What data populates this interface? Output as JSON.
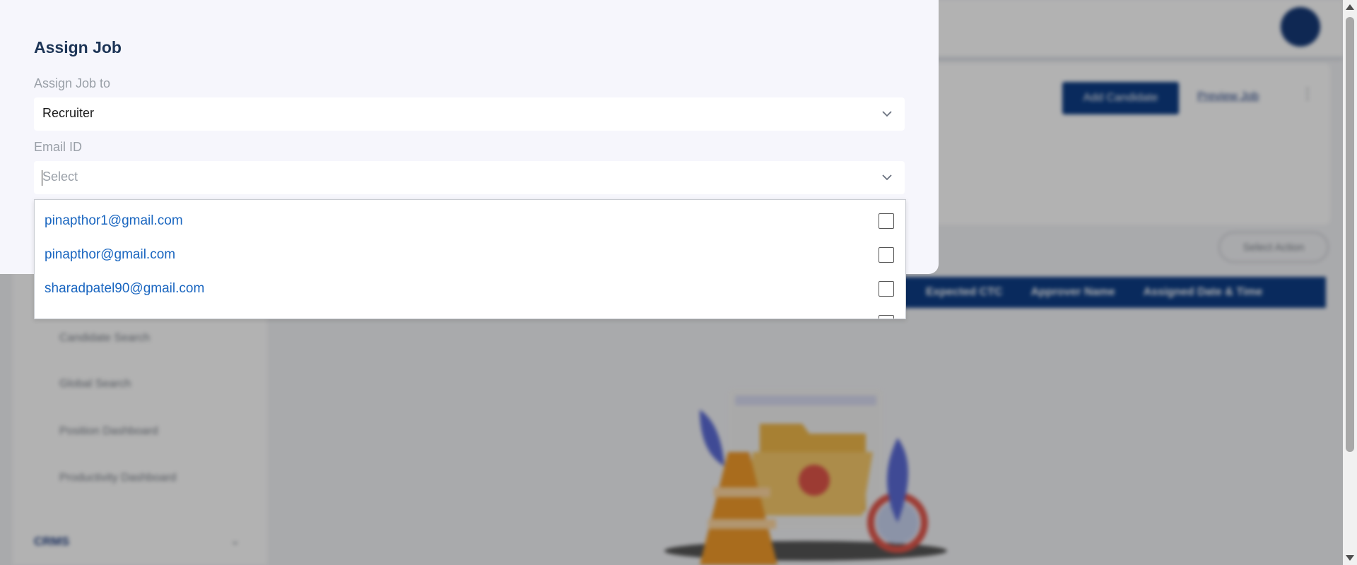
{
  "modal": {
    "title": "Assign Job",
    "assign_to": {
      "label": "Assign Job to",
      "value": "Recruiter"
    },
    "email": {
      "label": "Email ID",
      "placeholder": "Select"
    },
    "options": [
      {
        "email": "pinapthor1@gmail.com",
        "checked": false
      },
      {
        "email": "pinapthor@gmail.com",
        "checked": false
      },
      {
        "email": "sharadpatel90@gmail.com",
        "checked": false
      },
      {
        "email": "",
        "checked": false
      }
    ]
  },
  "background": {
    "add_candidate_label": "Add Candidate",
    "preview_job_label": "Preview Job",
    "select_action_label": "Select Action",
    "table_headers": [
      "Expected CTC",
      "Approver Name",
      "Assigned Date & Time"
    ],
    "sidebar_items": [
      "Candidate Search",
      "Global Search",
      "Position Dashboard",
      "Productivity Dashboard"
    ],
    "sidebar_section": "CRMS"
  },
  "colors": {
    "primary": "#0d3d86",
    "link": "#1a66c0",
    "title": "#1d3557",
    "modal_bg": "#f6f6fc"
  }
}
